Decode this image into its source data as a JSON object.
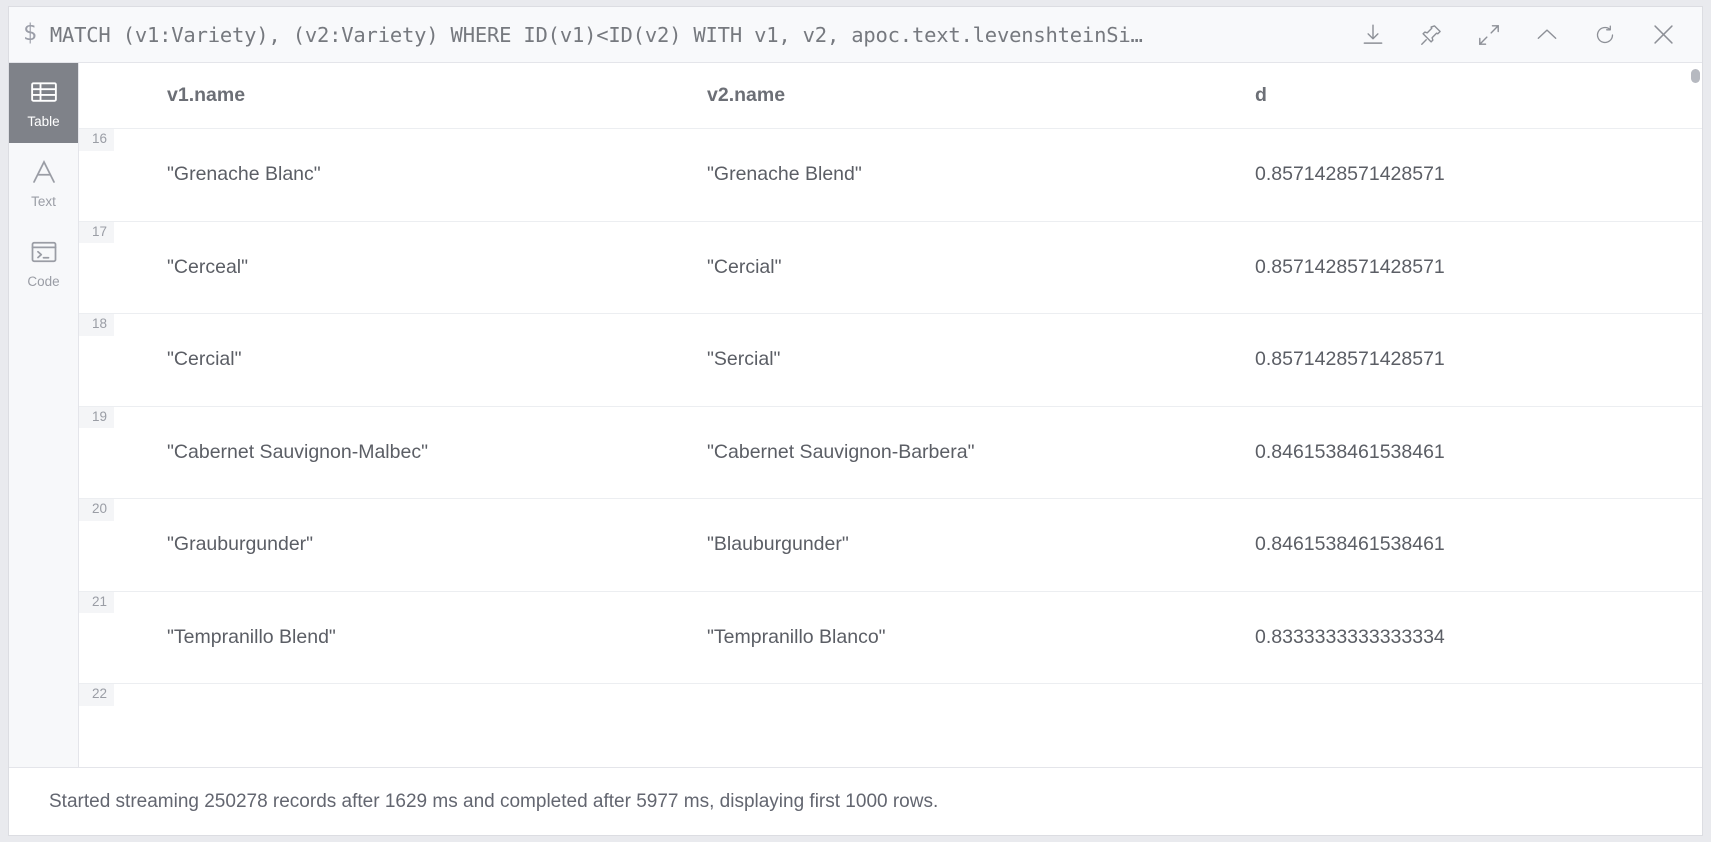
{
  "query_bar": {
    "sigil": "$",
    "query": "MATCH (v1:Variety), (v2:Variety) WHERE ID(v1)<ID(v2) WITH v1, v2, apoc.text.levenshteinSi…",
    "actions": [
      {
        "name": "download-icon",
        "label": "Download"
      },
      {
        "name": "pin-icon",
        "label": "Pin"
      },
      {
        "name": "expand-icon",
        "label": "Expand"
      },
      {
        "name": "collapse-icon",
        "label": "Collapse"
      },
      {
        "name": "refresh-icon",
        "label": "Refresh"
      },
      {
        "name": "close-icon",
        "label": "Close"
      }
    ]
  },
  "view_switcher": {
    "selected": "Table",
    "items": [
      {
        "label": "Table",
        "icon": "table-icon",
        "active": true
      },
      {
        "label": "Text",
        "icon": "text-icon",
        "active": false
      },
      {
        "label": "Code",
        "icon": "code-icon",
        "active": false
      }
    ]
  },
  "result_table": {
    "columns": [
      "v1.name",
      "v2.name",
      "d"
    ],
    "rows": [
      {
        "n": "16",
        "v1": "\"Grenache Blanc\"",
        "v2": "\"Grenache Blend\"",
        "d": "0.8571428571428571"
      },
      {
        "n": "17",
        "v1": "\"Cerceal\"",
        "v2": "\"Cercial\"",
        "d": "0.8571428571428571"
      },
      {
        "n": "18",
        "v1": "\"Cercial\"",
        "v2": "\"Sercial\"",
        "d": "0.8571428571428571"
      },
      {
        "n": "19",
        "v1": "\"Cabernet Sauvignon-Malbec\"",
        "v2": "\"Cabernet Sauvignon-Barbera\"",
        "d": "0.8461538461538461"
      },
      {
        "n": "20",
        "v1": "\"Grauburgunder\"",
        "v2": "\"Blauburgunder\"",
        "d": "0.8461538461538461"
      },
      {
        "n": "21",
        "v1": "\"Tempranillo Blend\"",
        "v2": "\"Tempranillo Blanco\"",
        "d": "0.8333333333333334"
      },
      {
        "n": "22",
        "v1": "",
        "v2": "",
        "d": ""
      }
    ]
  },
  "status_bar": {
    "message": "Started streaming 250278 records after 1629 ms and completed after 5977 ms, displaying first 1000 rows."
  },
  "colors": {
    "accent_active": "#7f8289",
    "text_primary": "#5b5e65",
    "text_muted": "#9a9da5",
    "panel_bg": "#f7f8fa",
    "border": "#e4e5ea"
  }
}
